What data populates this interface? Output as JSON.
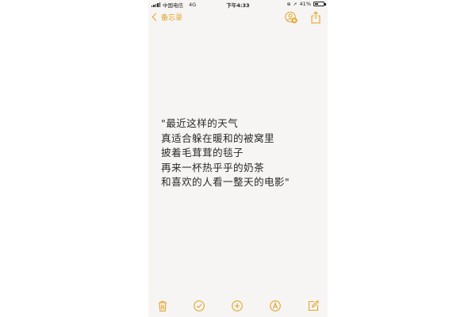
{
  "status_bar": {
    "carrier": "中国电信",
    "network": "4G",
    "time": "下午4:33",
    "battery": "41%",
    "battery_level": 0.41,
    "lock_icon": "orientation-lock-icon",
    "location_icon": "location-arrow-icon"
  },
  "nav": {
    "back_label": "备忘录",
    "add_people_icon": "add-people-icon",
    "share_icon": "share-icon"
  },
  "note": {
    "lines": [
      "\"最近这样的天气",
      " 真适合躲在暖和的被窝里",
      " 披着毛茸茸的毯子",
      " 再来一杯热乎乎的奶茶",
      " 和喜欢的人看一整天的电影\""
    ]
  },
  "toolbar": {
    "items": [
      "trash-icon",
      "checklist-icon",
      "add-icon",
      "markup-icon",
      "compose-icon"
    ]
  },
  "colors": {
    "accent": "#e3a32a",
    "paper": "#f6f5f3",
    "text": "#2a2a2a"
  }
}
